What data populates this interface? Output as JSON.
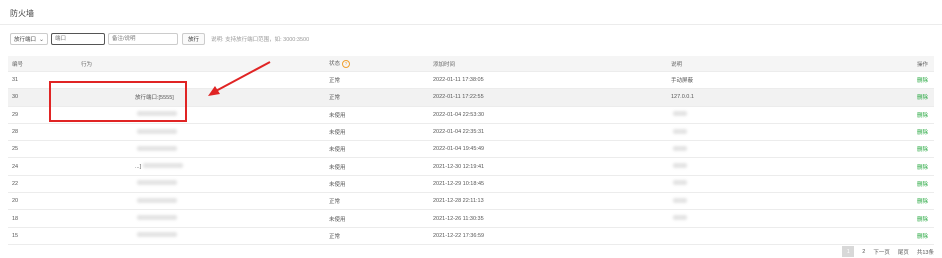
{
  "page": {
    "title": "防火墙"
  },
  "toolbar": {
    "select_value": "放行端口",
    "port_placeholder": "端口",
    "remark_placeholder": "备注/说明",
    "submit_label": "放行",
    "hint": "说明: 支持放行端口范围，如: 3000:3500"
  },
  "table": {
    "headers": {
      "id": "编号",
      "action": "行为",
      "status": "状态",
      "time": "添加时间",
      "remark": "说明",
      "op": "操作"
    },
    "rows": [
      {
        "id": "31",
        "action": "",
        "status": "正常",
        "time": "2022-01-11 17:38:05",
        "remark": "手动屏蔽",
        "op": "删除"
      },
      {
        "id": "30",
        "action": "放行端口:[5555]",
        "status": "正常",
        "time": "2022-01-11 17:22:55",
        "remark": "127.0.0.1",
        "op": "删除"
      },
      {
        "id": "29",
        "action": "",
        "status": "未使用",
        "time": "2022-01-04 22:53:30",
        "remark": "",
        "op": "删除"
      },
      {
        "id": "28",
        "action": "",
        "status": "未使用",
        "time": "2022-01-04 22:35:31",
        "remark": "",
        "op": "删除"
      },
      {
        "id": "25",
        "action": "",
        "status": "未使用",
        "time": "2022-01-04 19:45:49",
        "remark": "",
        "op": "删除"
      },
      {
        "id": "24",
        "action": "...]",
        "status": "未使用",
        "time": "2021-12-30 12:19:41",
        "remark": "",
        "op": "删除"
      },
      {
        "id": "22",
        "action": "",
        "status": "未使用",
        "time": "2021-12-29 10:18:45",
        "remark": "",
        "op": "删除"
      },
      {
        "id": "20",
        "action": "",
        "status": "正常",
        "time": "2021-12-28 22:11:13",
        "remark": "",
        "op": "删除"
      },
      {
        "id": "18",
        "action": "",
        "status": "未使用",
        "time": "2021-12-26 11:30:35",
        "remark": "",
        "op": "删除"
      },
      {
        "id": "15",
        "action": "",
        "status": "正常",
        "time": "2021-12-22 17:36:59",
        "remark": "",
        "op": "删除"
      }
    ]
  },
  "pagination": {
    "current": "1",
    "page2": "2",
    "next": "下一页",
    "last": "尾页",
    "total": "共13条"
  },
  "colors": {
    "accent": "#20a53a",
    "annotation": "#e02424",
    "status_icon": "#f0a030"
  }
}
